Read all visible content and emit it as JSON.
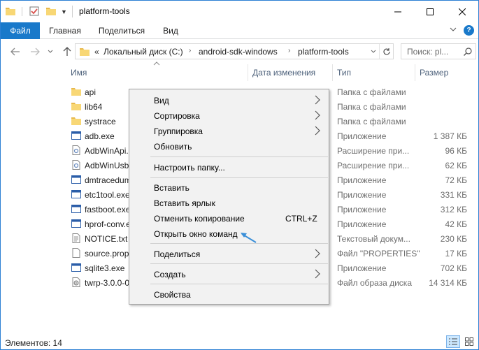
{
  "window": {
    "title": "platform-tools",
    "accent_color": "#1979ca"
  },
  "ribbon": {
    "tabs": [
      {
        "label": "Файл"
      },
      {
        "label": "Главная"
      },
      {
        "label": "Поделиться"
      },
      {
        "label": "Вид"
      }
    ],
    "help_label": "?"
  },
  "nav": {
    "address_overflow": "«",
    "breadcrumbs": [
      {
        "label": "Локальный диск (C:)"
      },
      {
        "label": "android-sdk-windows"
      },
      {
        "label": "platform-tools"
      }
    ],
    "search_placeholder": "Поиск: pl..."
  },
  "columns": {
    "name": "Имя",
    "date": "Дата изменения",
    "type": "Тип",
    "size": "Размер"
  },
  "files": [
    {
      "name": "api",
      "type": "Папка с файлами",
      "size": "",
      "icon": "folder-icon"
    },
    {
      "name": "lib64",
      "type": "Папка с файлами",
      "size": "",
      "icon": "folder-icon"
    },
    {
      "name": "systrace",
      "type": "Папка с файлами",
      "size": "",
      "icon": "folder-icon"
    },
    {
      "name": "adb.exe",
      "type": "Приложение",
      "size": "1 387 КБ",
      "icon": "exe-icon"
    },
    {
      "name": "AdbWinApi.dll",
      "type": "Расширение при...",
      "size": "96 КБ",
      "icon": "dll-icon"
    },
    {
      "name": "AdbWinUsbApi.dll",
      "type": "Расширение при...",
      "size": "62 КБ",
      "icon": "dll-icon"
    },
    {
      "name": "dmtracedump.exe",
      "type": "Приложение",
      "size": "72 КБ",
      "icon": "exe-icon"
    },
    {
      "name": "etc1tool.exe",
      "type": "Приложение",
      "size": "331 КБ",
      "icon": "exe-icon"
    },
    {
      "name": "fastboot.exe",
      "type": "Приложение",
      "size": "312 КБ",
      "icon": "exe-icon"
    },
    {
      "name": "hprof-conv.exe",
      "type": "Приложение",
      "size": "42 КБ",
      "icon": "exe-icon"
    },
    {
      "name": "NOTICE.txt",
      "type": "Текстовый докум...",
      "size": "230 КБ",
      "icon": "text-file-icon"
    },
    {
      "name": "source.properties",
      "type": "Файл \"PROPERTIES\"",
      "size": "17 КБ",
      "icon": "file-icon"
    },
    {
      "name": "sqlite3.exe",
      "type": "Приложение",
      "size": "702 КБ",
      "icon": "exe-icon"
    },
    {
      "name": "twrp-3.0.0-0.img",
      "type": "Файл образа диска",
      "size": "14 314 КБ",
      "icon": "disk-image-icon"
    }
  ],
  "status": {
    "items_count": "Элементов: 14"
  },
  "context_menu": {
    "items": [
      {
        "label": "Вид",
        "submenu": true
      },
      {
        "label": "Сортировка",
        "submenu": true
      },
      {
        "label": "Группировка",
        "submenu": true
      },
      {
        "label": "Обновить"
      },
      {
        "label": "Настроить папку..."
      },
      {
        "label": "Вставить"
      },
      {
        "label": "Вставить ярлык"
      },
      {
        "label": "Отменить копирование",
        "shortcut": "CTRL+Z"
      },
      {
        "label": "Открыть окно команд"
      },
      {
        "label": "Поделиться",
        "submenu": true
      },
      {
        "label": "Создать",
        "submenu": true
      },
      {
        "label": "Свойства"
      }
    ]
  }
}
